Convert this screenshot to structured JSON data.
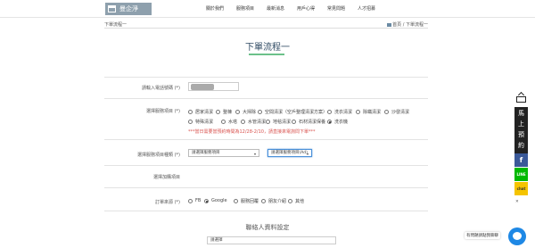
{
  "header": {
    "logo_text": "曼企淨",
    "nav": [
      "關於我們",
      "服務項目",
      "最新消息",
      "用戶心得",
      "常見問題",
      "人才招募"
    ]
  },
  "breadcrumb": {
    "left": "下單流程一",
    "right": "首頁 / 下單流程一"
  },
  "page_title": "下單流程一",
  "form": {
    "phone_label": "請輸入電話號碼 (*)",
    "service_label": "選擇服務項目 (*)",
    "services_row1": [
      "居家清潔",
      "整棟",
      "大掃除",
      "空間清潔（空戶整理清潔方案）",
      "洗衣清潔",
      "除蟎清潔",
      "沙發清潔"
    ],
    "services_row2": [
      "特殊清潔",
      "水塔",
      "水管清潔",
      "地毯清潔",
      "石材清潔保養",
      "洗衣機"
    ],
    "selected_service": "洗衣機",
    "notice": "***當日需要當預約時間為12/28-2/10，請直接來電詢問下單***",
    "notice_link": "來電詢問下單",
    "category_label": "選擇服務項目種類 (*)",
    "category_select_1": "請選擇服務項目",
    "category_select_2": "請選擇服務項目(Ad)",
    "selected_items_label": "選擇加購項目",
    "source_label": "訂單來源 (*)",
    "sources": [
      "FB",
      "Google",
      "服務回覆",
      "朋友介紹",
      "其他"
    ],
    "selected_source": "Google"
  },
  "contact": {
    "section_title": "聯絡人資料設定",
    "select_placeholder": "請選擇"
  },
  "side": {
    "vertical_text": [
      "馬",
      "上",
      "預",
      "約"
    ],
    "fb_icon": "f",
    "line_icon": "LINE",
    "chat_icon": "chat",
    "close_label": "✕"
  },
  "messenger": {
    "label": "有問題請點我聊聊"
  }
}
